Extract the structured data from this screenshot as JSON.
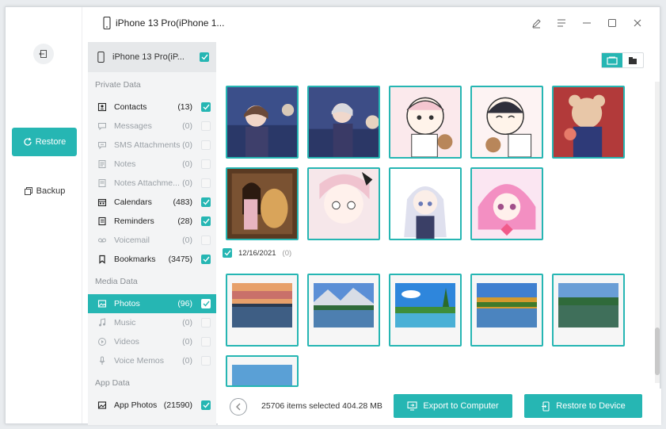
{
  "device": {
    "title": "iPhone 13 Pro(iPhone 1...",
    "short": "iPhone 13 Pro(iP..."
  },
  "rail": {
    "restore_label": "Restore",
    "backup_label": "Backup"
  },
  "sections": {
    "private": "Private Data",
    "media": "Media Data",
    "app": "App Data"
  },
  "private_items": [
    {
      "label": "Contacts",
      "count": "(13)",
      "checked": true,
      "dim": false,
      "icon": "contacts-icon"
    },
    {
      "label": "Messages",
      "count": "(0)",
      "checked": false,
      "dim": true,
      "icon": "messages-icon"
    },
    {
      "label": "SMS Attachments",
      "count": "(0)",
      "checked": false,
      "dim": true,
      "icon": "sms-attachments-icon"
    },
    {
      "label": "Notes",
      "count": "(0)",
      "checked": false,
      "dim": true,
      "icon": "notes-icon"
    },
    {
      "label": "Notes Attachme...",
      "count": "(0)",
      "checked": false,
      "dim": true,
      "icon": "notes-attachments-icon"
    },
    {
      "label": "Calendars",
      "count": "(483)",
      "checked": true,
      "dim": false,
      "icon": "calendar-icon"
    },
    {
      "label": "Reminders",
      "count": "(28)",
      "checked": true,
      "dim": false,
      "icon": "reminders-icon"
    },
    {
      "label": "Voicemail",
      "count": "(0)",
      "checked": false,
      "dim": true,
      "icon": "voicemail-icon"
    },
    {
      "label": "Bookmarks",
      "count": "(3475)",
      "checked": true,
      "dim": false,
      "icon": "bookmark-icon"
    }
  ],
  "media_items": [
    {
      "label": "Photos",
      "count": "(96)",
      "checked": true,
      "dim": false,
      "selected": true,
      "icon": "photos-icon"
    },
    {
      "label": "Music",
      "count": "(0)",
      "checked": false,
      "dim": true,
      "icon": "music-icon"
    },
    {
      "label": "Videos",
      "count": "(0)",
      "checked": false,
      "dim": true,
      "icon": "videos-icon"
    },
    {
      "label": "Voice Memos",
      "count": "(0)",
      "checked": false,
      "dim": true,
      "icon": "voice-memo-icon"
    }
  ],
  "app_items": [
    {
      "label": "App Photos",
      "count": "(21590)",
      "checked": true,
      "dim": false,
      "icon": "app-photos-icon"
    }
  ],
  "group": {
    "date": "12/16/2021",
    "count": "(0)"
  },
  "status": "25706 items selected 404.28 MB",
  "buttons": {
    "export": "Export to Computer",
    "restore": "Restore to Device"
  },
  "colors": {
    "accent": "#26b6b3"
  }
}
